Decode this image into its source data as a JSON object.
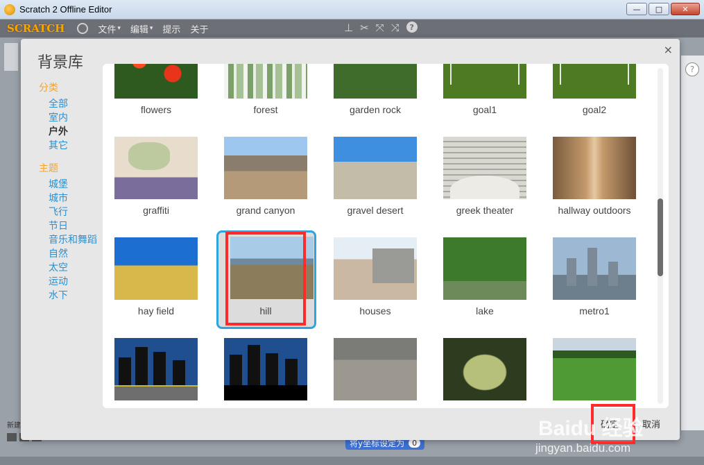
{
  "window": {
    "title": "Scratch 2 Offline Editor",
    "minimize": "—",
    "maximize": "□",
    "close": "✕"
  },
  "menubar": {
    "logo": "SCRATCH",
    "items": [
      {
        "label": "文件",
        "arrow": "▾"
      },
      {
        "label": "编辑",
        "arrow": "▾"
      },
      {
        "label": "提示",
        "arrow": ""
      },
      {
        "label": "关于",
        "arrow": ""
      }
    ],
    "tool_icons": [
      "stamp-icon",
      "cut-icon",
      "grow-icon",
      "shrink-icon"
    ],
    "help": "?"
  },
  "dialog": {
    "title": "背景库",
    "close": "×",
    "categories_header": "分类",
    "categories": [
      "全部",
      "室内",
      "户外",
      "其它"
    ],
    "selected_category": "户外",
    "themes_header": "主题",
    "themes": [
      "城堡",
      "城市",
      "飞行",
      "节日",
      "音乐和舞蹈",
      "自然",
      "太空",
      "运动",
      "水下"
    ],
    "tiles": [
      {
        "label": "flowers"
      },
      {
        "label": "forest"
      },
      {
        "label": "garden rock"
      },
      {
        "label": "goal1"
      },
      {
        "label": "goal2"
      },
      {
        "label": "graffiti"
      },
      {
        "label": "grand canyon"
      },
      {
        "label": "gravel desert"
      },
      {
        "label": "greek theater"
      },
      {
        "label": "hallway outdoors"
      },
      {
        "label": "hay field"
      },
      {
        "label": "hill",
        "selected": true
      },
      {
        "label": "houses"
      },
      {
        "label": "lake"
      },
      {
        "label": "metro1"
      },
      {
        "label": ""
      },
      {
        "label": ""
      },
      {
        "label": ""
      },
      {
        "label": ""
      },
      {
        "label": ""
      }
    ],
    "ok_label": "确定",
    "cancel_label": "取消"
  },
  "background": {
    "help": "?",
    "new_label": "新建",
    "block_label": "将y坐标设定为",
    "block_value": "0"
  },
  "watermark": {
    "line1": "Baidu 经验",
    "line2": "jingyan.baidu.com"
  },
  "colors": {
    "accent": "#2aa5e0",
    "category_header": "#f4a42a",
    "category_link": "#2b8fcf",
    "highlight": "#ff2a2a"
  }
}
